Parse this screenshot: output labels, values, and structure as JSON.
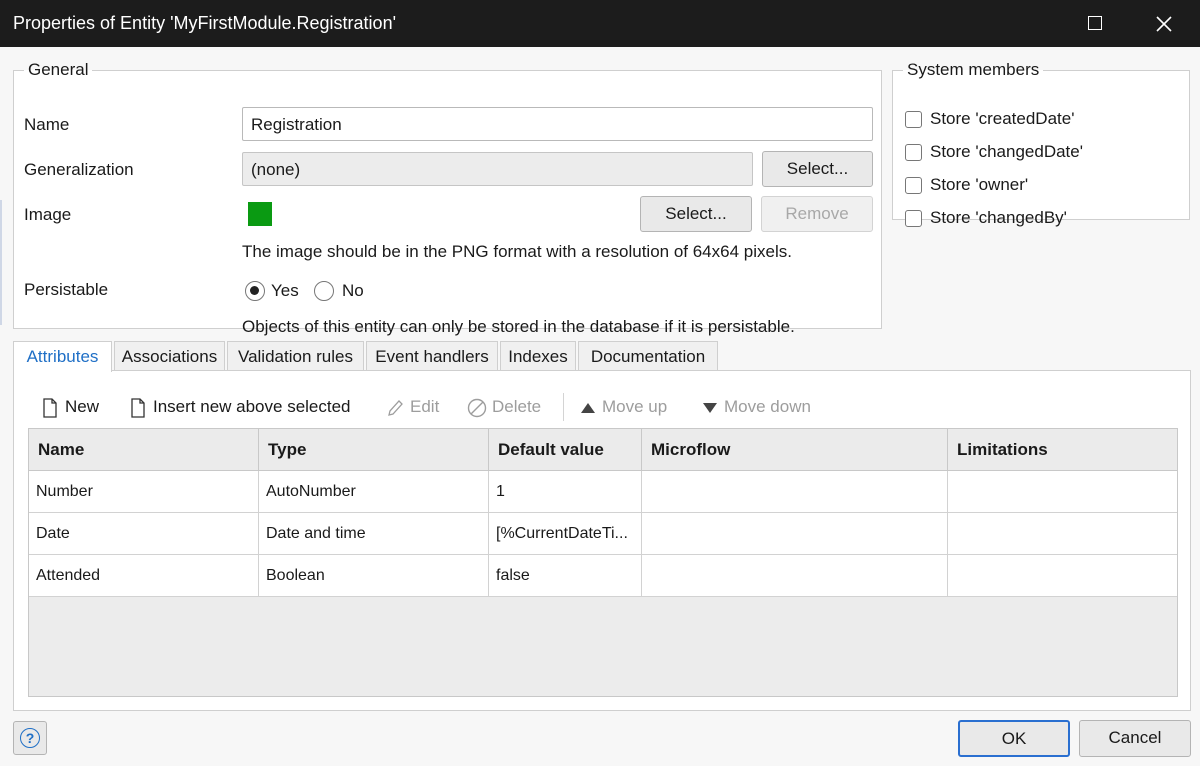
{
  "window": {
    "title": "Properties of Entity 'MyFirstModule.Registration'"
  },
  "general": {
    "legend": "General",
    "name_label": "Name",
    "name_value": "Registration",
    "generalization_label": "Generalization",
    "generalization_value": "(none)",
    "generalization_select": "Select...",
    "image_label": "Image",
    "image_color": "#0a9a12",
    "image_select": "Select...",
    "image_remove": "Remove",
    "image_hint": "The image should be in the PNG format with a resolution of 64x64 pixels.",
    "persistable_label": "Persistable",
    "persistable_yes": "Yes",
    "persistable_no": "No",
    "persistable_selected": "Yes",
    "persistable_hint": "Objects of this entity can only be stored in the database if it is persistable."
  },
  "system_members": {
    "legend": "System members",
    "items": [
      {
        "label": "Store 'createdDate'",
        "checked": false
      },
      {
        "label": "Store 'changedDate'",
        "checked": false
      },
      {
        "label": "Store 'owner'",
        "checked": false
      },
      {
        "label": "Store 'changedBy'",
        "checked": false
      }
    ]
  },
  "tabs": [
    {
      "label": "Attributes",
      "active": true
    },
    {
      "label": "Associations",
      "active": false
    },
    {
      "label": "Validation rules",
      "active": false
    },
    {
      "label": "Event handlers",
      "active": false
    },
    {
      "label": "Indexes",
      "active": false
    },
    {
      "label": "Documentation",
      "active": false
    }
  ],
  "toolbar": {
    "new": "New",
    "insert": "Insert new above selected",
    "edit": "Edit",
    "delete": "Delete",
    "move_up": "Move up",
    "move_down": "Move down"
  },
  "table": {
    "columns": [
      "Name",
      "Type",
      "Default value",
      "Microflow",
      "Limitations"
    ],
    "rows": [
      [
        "Number",
        "AutoNumber",
        "1",
        "",
        ""
      ],
      [
        "Date",
        "Date and time",
        "[%CurrentDateTi...",
        "",
        ""
      ],
      [
        "Attended",
        "Boolean",
        "false",
        "",
        ""
      ]
    ]
  },
  "footer": {
    "help_icon": "?",
    "ok": "OK",
    "cancel": "Cancel"
  },
  "colors": {
    "accent": "#1f6fc6",
    "titlebar": "#1c1c1c"
  }
}
